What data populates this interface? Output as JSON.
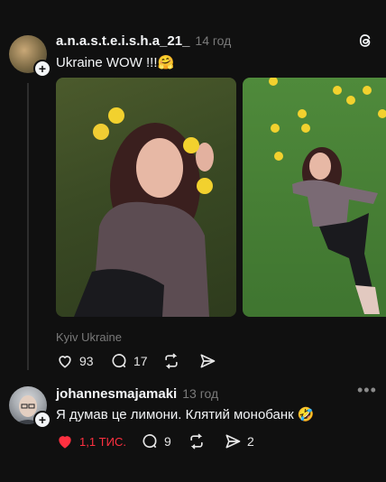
{
  "post": {
    "username": "a.n.a.s.t.e.i.s.h.a_21_",
    "time": "14 год",
    "text": "Ukraine WOW !!!🤗",
    "location": "Kyiv Ukraine",
    "actions": {
      "likes": "93",
      "comments": "17"
    }
  },
  "reply": {
    "username": "johannesmajamaki",
    "time": "13 год",
    "text": "Я думав це лимони. Клятий монобанк 🤣",
    "actions": {
      "likes": "1,1 тис.",
      "comments": "9",
      "shares": "2"
    }
  },
  "colors": {
    "background": "#101010",
    "like_active": "#ff3040",
    "text": "#f3f5f7",
    "muted": "#7a7a7a"
  },
  "icons": [
    "threads-logo-icon",
    "heart-icon",
    "comment-icon",
    "repost-icon",
    "share-icon",
    "more-icon"
  ]
}
